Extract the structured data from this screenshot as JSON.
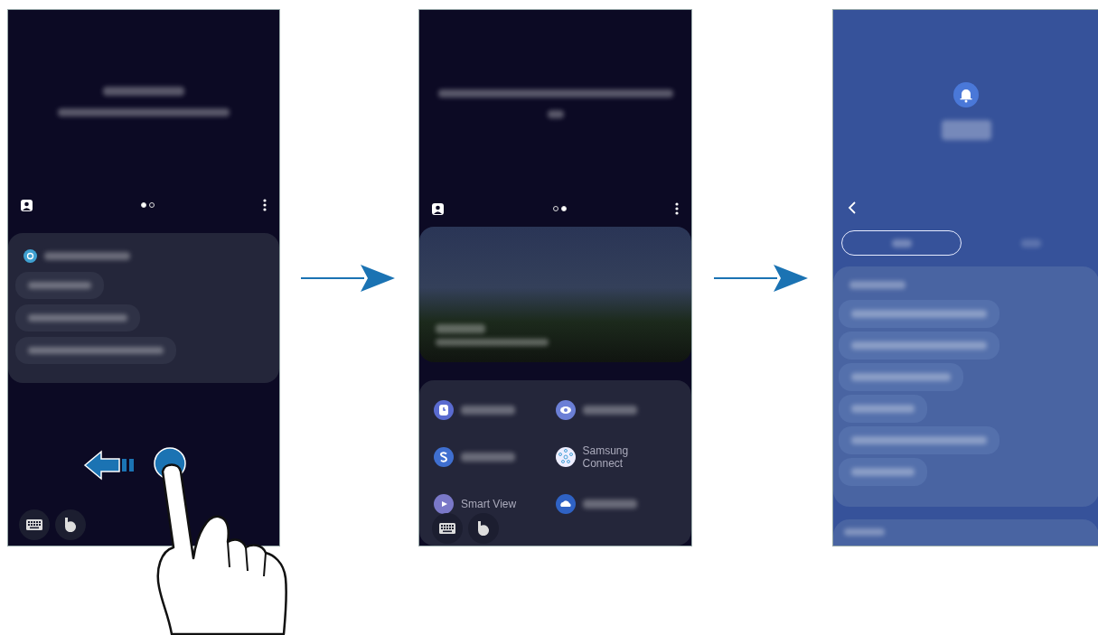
{
  "screens": [
    {
      "kind": "assistant",
      "page_dots": [
        {
          "selected": true
        },
        {
          "selected": false
        }
      ],
      "bubbles": [
        {
          "kind": "short"
        },
        {
          "kind": "medium"
        },
        {
          "kind": "long"
        }
      ]
    },
    {
      "kind": "discover",
      "page_dots": [
        {
          "selected": false
        },
        {
          "selected": true
        }
      ],
      "apps": [
        {
          "kind": "clock"
        },
        {
          "kind": "eye"
        },
        {
          "kind": "coin"
        },
        {
          "kind": "network",
          "label": "Samsung Connect"
        },
        {
          "kind": "cast",
          "label": "Smart View"
        },
        {
          "kind": "cloud"
        }
      ]
    },
    {
      "kind": "reminder",
      "tabs": [
        {
          "selected": true
        },
        {
          "selected": false
        }
      ],
      "bubbles": [
        {
          "kind": "long"
        },
        {
          "kind": "long"
        },
        {
          "kind": "medium"
        },
        {
          "kind": "short"
        },
        {
          "kind": "long"
        },
        {
          "kind": "short"
        }
      ]
    }
  ]
}
